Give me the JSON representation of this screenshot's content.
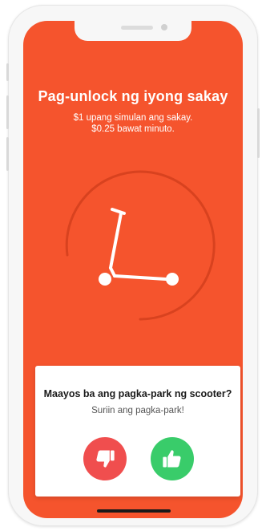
{
  "unlock": {
    "title": "Pag-unlock ng iyong sakay",
    "price_line_1": "$1 upang simulan ang sakay.",
    "price_line_2": "$0.25 bawat minuto."
  },
  "icons": {
    "main": "scooter-icon",
    "progress": "progress-ring",
    "dislike": "thumbs-down-icon",
    "like": "thumbs-up-icon"
  },
  "parking_check": {
    "question": "Maayos ba ang pagka-park ng scooter?",
    "instruction": "Suriin ang pagka-park!"
  },
  "colors": {
    "background": "#f5542d",
    "progress_arc": "#d8421f",
    "dislike_button": "#f04e4e",
    "like_button": "#39cc6a",
    "card": "#ffffff"
  }
}
